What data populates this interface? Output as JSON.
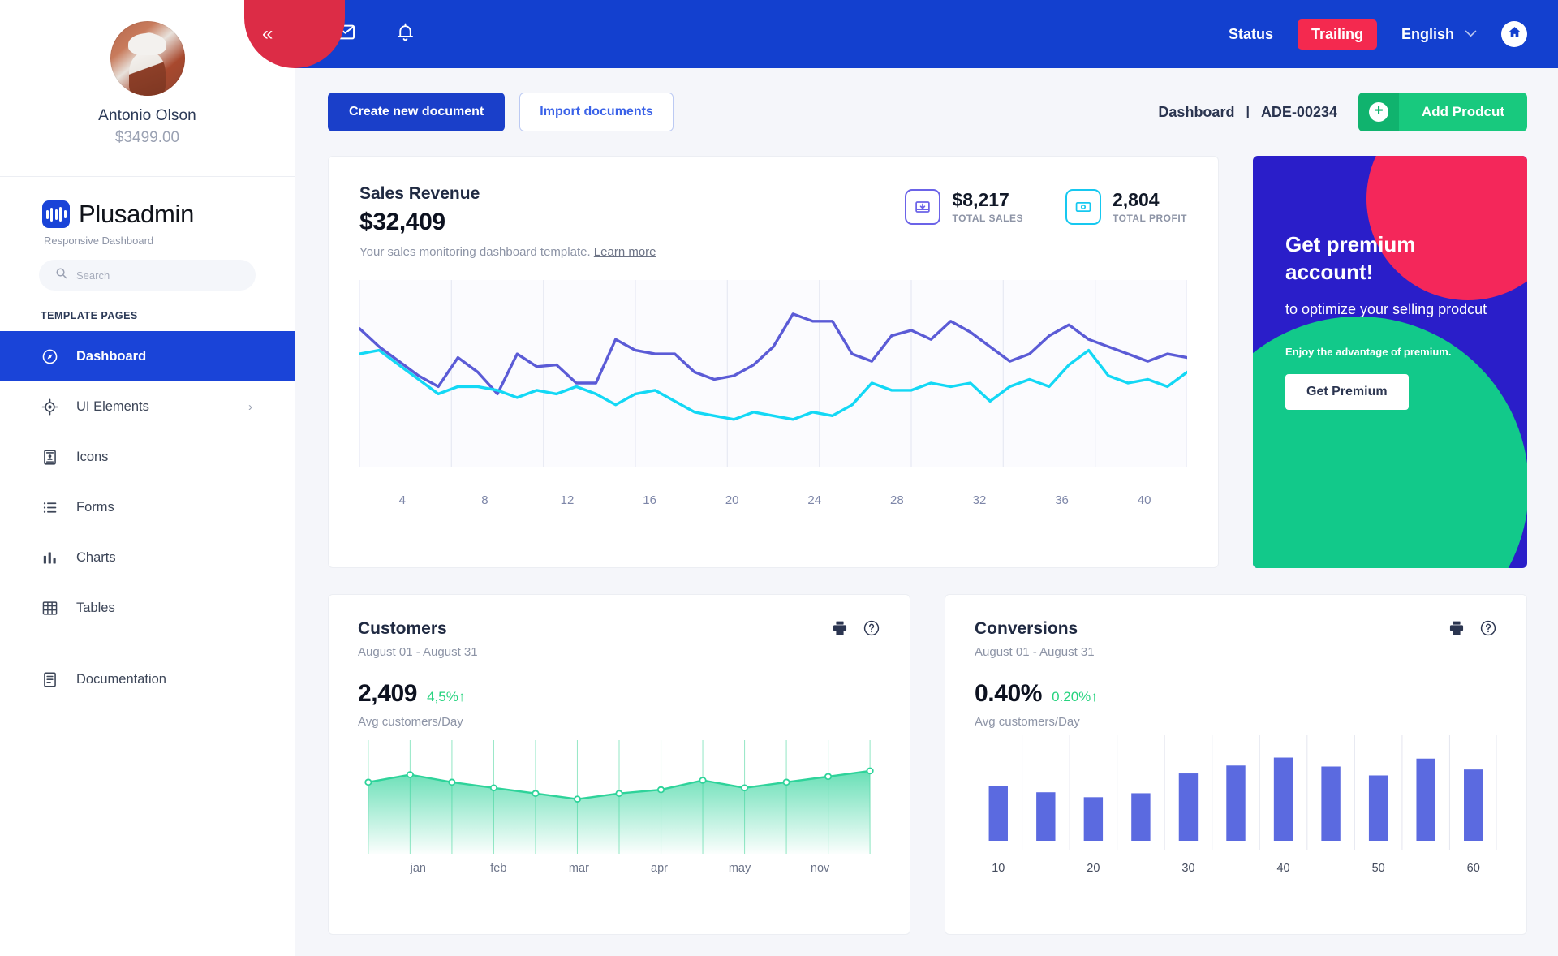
{
  "sidebar": {
    "profile": {
      "name": "Antonio Olson",
      "amount": "$3499.00",
      "avatar_icon": "user-avatar"
    },
    "collapse_icon": "double-chevron-left-icon",
    "brand": {
      "name": "Plusadmin",
      "subtitle": "Responsive Dashboard",
      "mark_icon": "plusadmin-logo-icon"
    },
    "search": {
      "placeholder": "Search",
      "value": "",
      "icon": "search-icon"
    },
    "nav_title": "TEMPLATE PAGES",
    "items": [
      {
        "label": "Dashboard",
        "icon": "compass-icon",
        "active": true
      },
      {
        "label": "UI Elements",
        "icon": "target-icon",
        "active": false,
        "chevron": "›"
      },
      {
        "label": "Icons",
        "icon": "id-card-icon",
        "active": false
      },
      {
        "label": "Forms",
        "icon": "list-icon",
        "active": false
      },
      {
        "label": "Charts",
        "icon": "bar-chart-icon",
        "active": false
      },
      {
        "label": "Tables",
        "icon": "table-icon",
        "active": false
      },
      {
        "label": "Documentation",
        "icon": "document-icon",
        "active": false
      }
    ]
  },
  "topbar": {
    "mail_icon": "envelope-icon",
    "bell_icon": "bell-icon",
    "status_label": "Status",
    "trailing_label": "Trailing",
    "language_label": "English",
    "language_caret_icon": "chevron-down-icon",
    "home_icon": "home-icon",
    "bg_color": "#1340cf",
    "pill_color": "#f4294f"
  },
  "actionbar": {
    "create_label": "Create new document",
    "import_label": "Import documents",
    "breadcrumb_page": "Dashboard",
    "breadcrumb_sep": "|",
    "breadcrumb_code": "ADE-00234",
    "add_product_label": "Add Prodcut",
    "add_product_icon": "plus-circle-icon",
    "add_color": "#18c97e"
  },
  "revenue": {
    "title": "Sales Revenue",
    "value": "$32,409",
    "subtitle": "Your sales monitoring dashboard template.",
    "learn_more": "Learn more",
    "stats": [
      {
        "value": "$8,217",
        "label": "TOTAL SALES",
        "icon": "inbox-download-icon",
        "color": "#6b63e8"
      },
      {
        "value": "2,804",
        "label": "TOTAL PROFIT",
        "icon": "money-icon",
        "color": "#16c8f0"
      }
    ]
  },
  "promo": {
    "title": "Get premium account!",
    "description": "to optimize your selling prodcut",
    "note": "Enjoy the advantage of premium.",
    "button_label": "Get Premium",
    "bg_color": "#2a1ec9",
    "pink_color": "#f4275a",
    "green_color": "#12c98a"
  },
  "customers": {
    "title": "Customers",
    "range": "August 01 - August 31",
    "value": "2,409",
    "delta": "4,5%",
    "delta_arrow": "↑",
    "sub": "Avg customers/Day",
    "print_icon": "printer-icon",
    "help_icon": "question-circle-icon"
  },
  "conversions": {
    "title": "Conversions",
    "range": "August 01 - August 31",
    "value": "0.40%",
    "delta": "0.20%",
    "delta_arrow": "↑",
    "sub": "Avg customers/Day",
    "print_icon": "printer-icon",
    "help_icon": "question-circle-icon"
  },
  "chart_data": [
    {
      "type": "line",
      "id": "sales-revenue-chart",
      "title": "Sales Revenue",
      "xlabel": "",
      "ylabel": "",
      "grid": true,
      "legend": "none",
      "xlim": [
        2,
        40
      ],
      "ylim": [
        0,
        100
      ],
      "xticks": [
        4,
        8,
        12,
        16,
        20,
        24,
        28,
        32,
        36,
        40
      ],
      "x": [
        2,
        3,
        4,
        5,
        6,
        7,
        8,
        9,
        10,
        11,
        12,
        13,
        14,
        15,
        16,
        17,
        18,
        19,
        20,
        21,
        22,
        23,
        24,
        25,
        26,
        27,
        28,
        29,
        30,
        31,
        32,
        33,
        34,
        35,
        36,
        37,
        38,
        39,
        40
      ],
      "series": [
        {
          "name": "Revenue",
          "color": "#5b5bd6",
          "values": [
            76,
            66,
            58,
            50,
            44,
            60,
            52,
            40,
            62,
            55,
            56,
            46,
            46,
            70,
            64,
            62,
            62,
            52,
            48,
            50,
            56,
            66,
            84,
            80,
            80,
            62,
            58,
            72,
            75,
            70,
            80,
            74,
            66,
            58,
            62,
            72,
            78,
            70,
            66,
            62,
            58,
            62,
            60
          ]
        },
        {
          "name": "Profit",
          "color": "#13d8f5",
          "values": [
            62,
            64,
            56,
            48,
            40,
            44,
            44,
            42,
            38,
            42,
            40,
            44,
            40,
            34,
            40,
            42,
            36,
            30,
            28,
            26,
            30,
            28,
            26,
            30,
            28,
            34,
            46,
            42,
            42,
            46,
            44,
            46,
            36,
            44,
            48,
            44,
            56,
            64,
            50,
            46,
            48,
            44,
            52
          ]
        }
      ]
    },
    {
      "type": "area",
      "id": "customers-chart",
      "title": "Customers",
      "ylabel": "Avg customers/Day",
      "grid": true,
      "color": "#2ed39a",
      "categories": [
        "",
        "jan",
        "",
        "feb",
        "",
        "mar",
        "",
        "apr",
        "",
        "may",
        "",
        "nov",
        ""
      ],
      "xticks": [
        "jan",
        "feb",
        "mar",
        "apr",
        "may",
        "nov"
      ],
      "values": [
        64,
        72,
        64,
        58,
        52,
        46,
        52,
        56,
        66,
        58,
        64,
        70,
        76
      ],
      "ylim": [
        0,
        100
      ]
    },
    {
      "type": "bar",
      "id": "conversions-chart",
      "title": "Conversions",
      "ylabel": "Avg customers/Day",
      "color": "#5b6ae0",
      "categories": [
        "10",
        "",
        "20",
        "",
        "30",
        "",
        "40",
        "",
        "50",
        "",
        "60"
      ],
      "xticks": [
        "10",
        "20",
        "30",
        "40",
        "50",
        "60"
      ],
      "values": [
        55,
        49,
        44,
        48,
        68,
        76,
        84,
        75,
        66,
        83,
        72
      ],
      "ylim": [
        0,
        100
      ]
    }
  ]
}
